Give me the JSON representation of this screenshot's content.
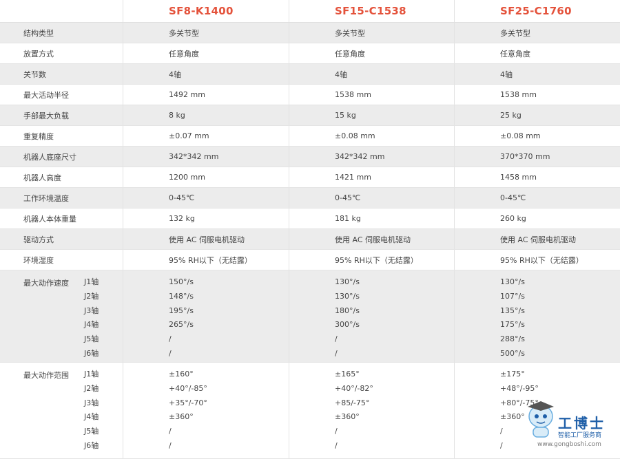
{
  "models": [
    "SF8-K1400",
    "SF15-C1538",
    "SF25-C1760"
  ],
  "rows": [
    {
      "label": "结构类型",
      "values": [
        "多关节型",
        "多关节型",
        "多关节型"
      ]
    },
    {
      "label": "放置方式",
      "values": [
        "任意角度",
        "任意角度",
        "任意角度"
      ]
    },
    {
      "label": "关节数",
      "values": [
        "4轴",
        "4轴",
        "4轴"
      ]
    },
    {
      "label": "最大活动半径",
      "values": [
        "1492 mm",
        "1538 mm",
        "1538 mm"
      ]
    },
    {
      "label": "手部最大负载",
      "values": [
        "8 kg",
        "15 kg",
        "25 kg"
      ]
    },
    {
      "label": "重复精度",
      "values": [
        "±0.07 mm",
        "±0.08 mm",
        "±0.08 mm"
      ]
    },
    {
      "label": "机器人底座尺寸",
      "values": [
        "342*342 mm",
        "342*342 mm",
        "370*370 mm"
      ]
    },
    {
      "label": "机器人高度",
      "values": [
        "1200 mm",
        "1421 mm",
        "1458 mm"
      ]
    },
    {
      "label": "工作环境温度",
      "values": [
        "0-45℃",
        "0-45℃",
        "0-45℃"
      ]
    },
    {
      "label": "机器人本体重量",
      "values": [
        "132 kg",
        "181 kg",
        "260 kg"
      ]
    },
    {
      "label": "驱动方式",
      "values": [
        "使用 AC 伺服电机驱动",
        "使用 AC 伺服电机驱动",
        "使用 AC 伺服电机驱动"
      ]
    },
    {
      "label": "环境湿度",
      "values": [
        "95% RH以下（无结露）",
        "95% RH以下（无结露）",
        "95% RH以下（无结露）"
      ]
    }
  ],
  "axes": [
    "J1轴",
    "J2轴",
    "J3轴",
    "J4轴",
    "J5轴",
    "J6轴"
  ],
  "speed": {
    "label": "最大动作速度",
    "cols": [
      [
        "150°/s",
        "148°/s",
        "195°/s",
        "265°/s",
        "/",
        "/"
      ],
      [
        "130°/s",
        "130°/s",
        "180°/s",
        "300°/s",
        "/",
        "/"
      ],
      [
        "130°/s",
        "107°/s",
        "135°/s",
        "175°/s",
        "288°/s",
        "500°/s"
      ]
    ]
  },
  "range": {
    "label": "最大动作范围",
    "cols": [
      [
        "±160°",
        "+40°/-85°",
        "+35°/-70°",
        "±360°",
        "/",
        "/"
      ],
      [
        "±165°",
        "+40°/-82°",
        "+85/-75°",
        "±360°",
        "/",
        "/"
      ],
      [
        "±175°",
        "+48°/-95°",
        "+80°/-75°",
        "±360°",
        "/",
        "/"
      ]
    ]
  },
  "watermark": {
    "name": "工博士",
    "sub": "智能工厂服务商",
    "url": "www.gongboshi.com"
  },
  "colors": {
    "accent": "#e4523b",
    "stripe": "#ececec",
    "watermark": "#1f5fa8"
  }
}
